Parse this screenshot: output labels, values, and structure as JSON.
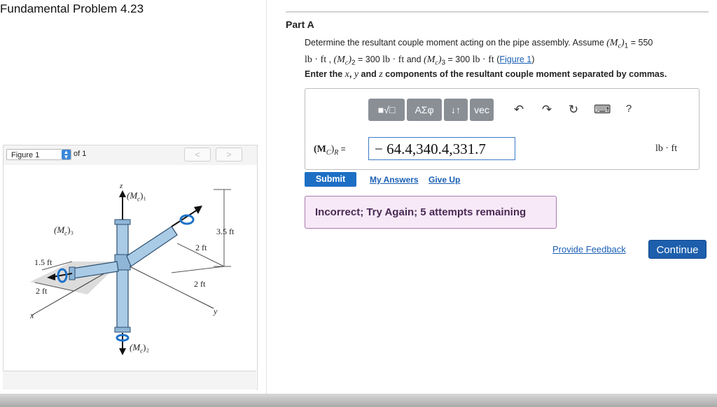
{
  "header": {
    "title": "Fundamental Problem 4.23"
  },
  "figure_panel": {
    "select_value": "Figure 1",
    "of_label": "of 1",
    "prev_label": "<",
    "next_label": ">",
    "labels": {
      "z": "z",
      "mc1": "(M",
      "mc1_sub": "c",
      "mc1_tail": ")₁",
      "mc3": "(M",
      "mc3_sub": "c",
      "mc3_tail": ")₃",
      "mc2": "(M",
      "mc2_sub": "c",
      "mc2_tail": ")₂",
      "dim_35": "3.5 ft",
      "dim_2a": "2 ft",
      "dim_2b": "2 ft",
      "dim_2c": "2 ft",
      "dim_15": "1.5 ft",
      "x": "x",
      "y": "y"
    }
  },
  "part": {
    "title": "Part A",
    "question_prefix": "Determine the resultant couple moment acting on the pipe assembly. Assume ",
    "mc1_expr": "(M",
    "mc1_sub": "c",
    "mc1_close": ")",
    "mc1_index": "1",
    "mc1_value": " = 550",
    "unit_lbft": "lb · ft",
    "sep1": " , ",
    "mc2_expr": "(M",
    "mc2_index": "2",
    "mc2_value": " = 300 ",
    "and_text": " and ",
    "mc3_index": "3",
    "mc3_value": " = 300 ",
    "figure_link": "Figure 1",
    "instruction_pre": "Enter the ",
    "x_var": "x",
    "comma": ", ",
    "y_var": "y",
    "and2": " and ",
    "z_var": "z",
    "instruction_post": " components of the resultant couple moment separated by commas."
  },
  "toolbar": {
    "template_label": "■√□",
    "greek_label": "ΑΣφ",
    "arrows_label": "↓↑",
    "vec_label": "vec",
    "undo_icon": "↶",
    "redo_icon": "↷",
    "reset_icon": "↻",
    "keyboard_icon": "⌨",
    "help_label": "?"
  },
  "answer": {
    "label_main": "(M",
    "label_sub": "C",
    "label_close": ")",
    "label_index": "R",
    "label_eq": " =",
    "value": "− 64.4,340.4,331.7",
    "unit": "lb · ft"
  },
  "actions": {
    "submit": "Submit",
    "my_answers": "My Answers",
    "give_up": "Give Up",
    "feedback": "Incorrect; Try Again; 5 attempts remaining",
    "provide_feedback": "Provide Feedback",
    "continue": "Continue"
  },
  "colors": {
    "accent": "#1d6fc4",
    "feedback_bg": "#f7e9f7",
    "pipe": "#a9cbe6"
  }
}
